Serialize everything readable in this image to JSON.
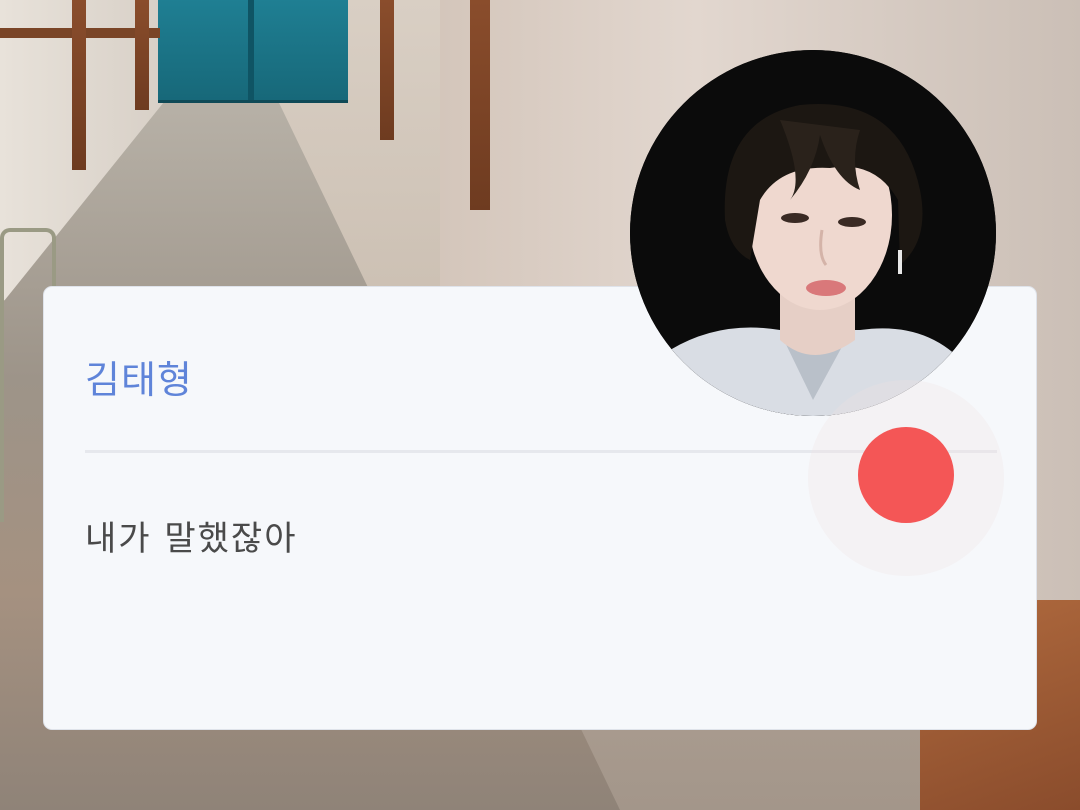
{
  "dialogue_box": {
    "speaker_name": "김태형",
    "message": "내가 말했잖아"
  },
  "colors": {
    "speaker_name": "#5f84d9",
    "message_text": "#4a4a4a",
    "card_background": "#f6f8fb",
    "divider": "#e6e8ed",
    "indicator_dot": "#f45656"
  },
  "icons": {
    "avatar": "character-portrait",
    "indicator": "red-dot-icon",
    "background": "school-hallway-scene"
  }
}
